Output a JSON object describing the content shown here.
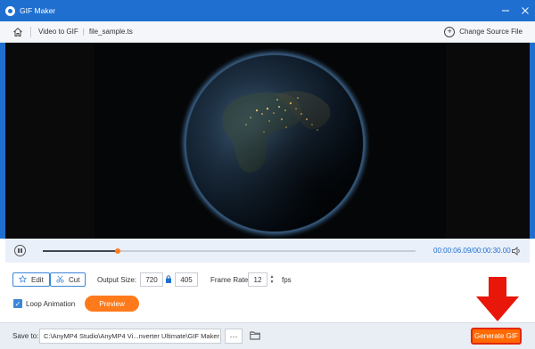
{
  "window": {
    "title": "GIF Maker",
    "minimize_icon": "minimize-icon",
    "close_icon": "close-icon",
    "title_bar_color": "#1f6fd0"
  },
  "nav": {
    "crumb_root": "Video to GIF",
    "crumb_file": "file_sample.ts",
    "change_source": "Change Source File"
  },
  "player": {
    "current_time": "00:00:06.09",
    "total_time": "00:00:30.00",
    "time_text": "00:00:06.09/00:00:30.00",
    "progress": 0.2
  },
  "settings": {
    "edit_label": "Edit",
    "cut_label": "Cut",
    "output_size_label": "Output Size:",
    "width": "720",
    "height": "405",
    "frame_rate_label": "Frame Rate:",
    "frame_rate": "12",
    "fps_label": "fps",
    "loop_label": "Loop Animation",
    "loop_checked": true,
    "preview_label": "Preview"
  },
  "footer": {
    "save_to_label": "Save to:",
    "save_path": "C:\\AnyMP4 Studio\\AnyMP4 Vi...nverter Ultimate\\GIF Maker",
    "dots_label": "···",
    "generate_label": "Generate GIF"
  },
  "colors": {
    "accent": "#1f6fd0",
    "orange": "#ff7a1a",
    "highlight_red": "#e3260a"
  }
}
